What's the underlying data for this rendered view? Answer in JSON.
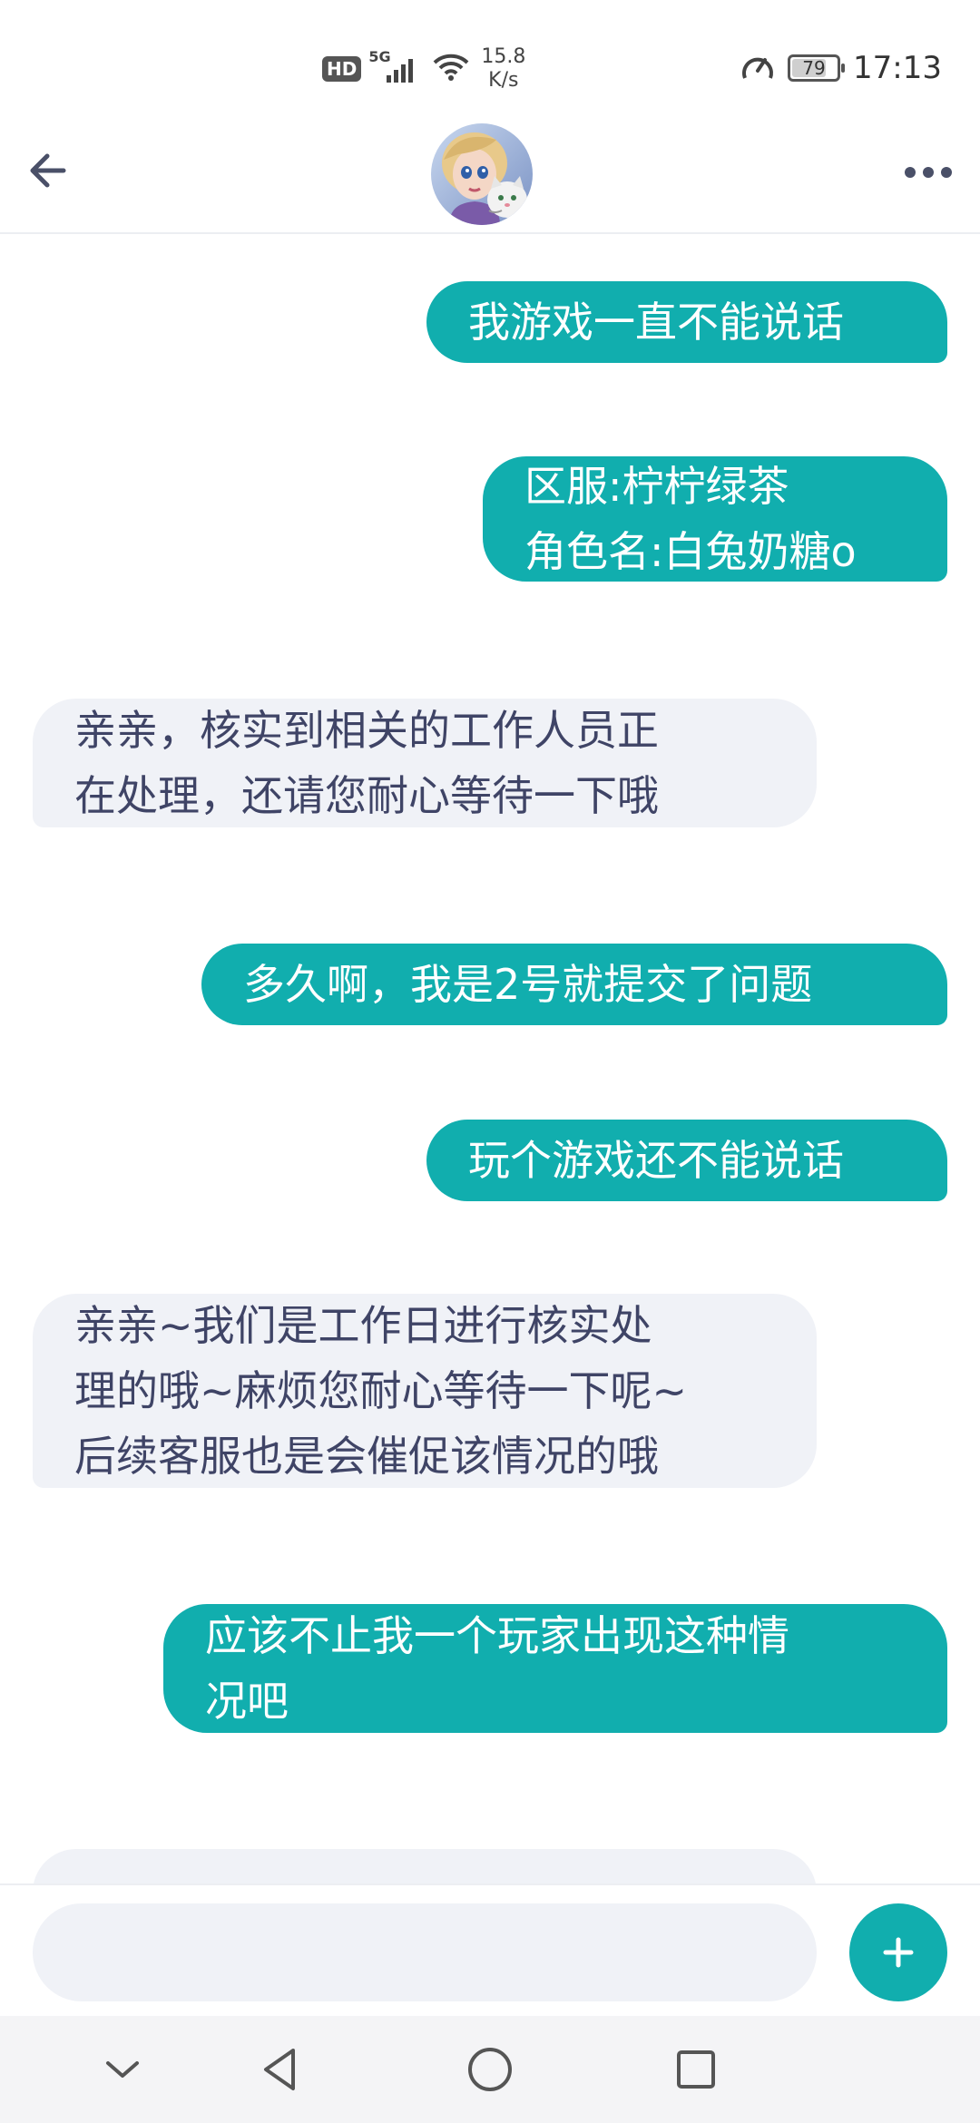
{
  "status_bar": {
    "hd": "HD",
    "network": "5G",
    "speed_value": "15.8",
    "speed_unit": "K/s",
    "battery": "79",
    "time": "17:13",
    "icons": [
      "hd-icon",
      "signal-icon",
      "wifi-icon",
      "data-saver-icon",
      "battery-icon"
    ]
  },
  "header": {
    "back_icon": "arrow-left-icon",
    "avatar": "game-character-avatar",
    "more_icon": "more-dots-icon"
  },
  "messages": [
    {
      "side": "out",
      "text": "我游戏一直不能说话"
    },
    {
      "side": "out",
      "text": "区服:柠柠绿茶\n角色名:白兔奶糖o"
    },
    {
      "side": "in",
      "text": "亲亲，核实到相关的工作人员正\n在处理，还请您耐心等待一下哦"
    },
    {
      "side": "out",
      "text": "多久啊，我是2号就提交了问题"
    },
    {
      "side": "out",
      "text": "玩个游戏还不能说话"
    },
    {
      "side": "in",
      "text": "亲亲~我们是工作日进行核实处\n理的哦~麻烦您耐心等待一下呢~\n后续客服也是会催促该情况的哦"
    },
    {
      "side": "out",
      "text": "应该不止我一个玩家出现这种情\n况吧"
    },
    {
      "side": "in",
      "text": ""
    }
  ],
  "composer": {
    "placeholder": "",
    "add_icon": "plus-icon"
  },
  "nav_bar": {
    "icons": [
      "chevron-down-icon",
      "back-triangle-icon",
      "home-circle-icon",
      "recents-square-icon"
    ]
  },
  "colors": {
    "accent": "#11aeae",
    "incoming_bubble": "#f0f2f7",
    "incoming_text": "#3f4466"
  }
}
